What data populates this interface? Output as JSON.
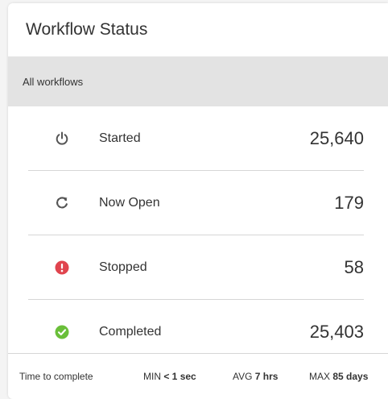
{
  "card": {
    "title": "Workflow Status",
    "filter_label": "All workflows"
  },
  "rows": [
    {
      "icon": "power-icon",
      "label": "Started",
      "value": "25,640",
      "color": "#555555"
    },
    {
      "icon": "refresh-icon",
      "label": "Now Open",
      "value": "179",
      "color": "#555555"
    },
    {
      "icon": "exclamation-circle-icon",
      "label": "Stopped",
      "value": "58",
      "color": "#e0444e"
    },
    {
      "icon": "check-circle-icon",
      "label": "Completed",
      "value": "25,403",
      "color": "#6abf3a"
    }
  ],
  "footer": {
    "label": "Time to complete",
    "min_label": "MIN",
    "min_value": "< 1 sec",
    "avg_label": "AVG",
    "avg_value": "7 hrs",
    "max_label": "MAX",
    "max_value": "85 days"
  }
}
